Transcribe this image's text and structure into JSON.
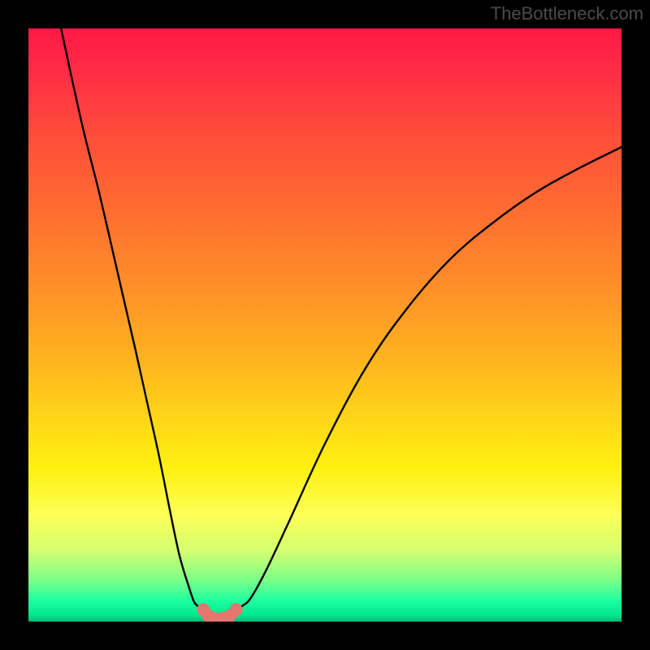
{
  "watermark": "TheBottleneck.com",
  "chart_data": {
    "type": "line",
    "title": "",
    "xlabel": "",
    "ylabel": "",
    "xlim": [
      0,
      100
    ],
    "ylim": [
      0,
      100
    ],
    "grid": false,
    "legend": false,
    "series": [
      {
        "name": "left-branch",
        "x": [
          5.5,
          9,
          12,
          15,
          18,
          20,
          22,
          24,
          25.5,
          27,
          28,
          29,
          29.5
        ],
        "y": [
          100,
          84,
          72,
          59,
          46,
          37,
          28,
          18,
          11,
          6,
          3.2,
          2.4,
          2
        ]
      },
      {
        "name": "right-branch",
        "x": [
          35,
          36,
          37.5,
          40,
          44,
          50,
          57,
          64,
          71,
          78,
          85,
          92,
          100
        ],
        "y": [
          2,
          2.6,
          4,
          8.5,
          17,
          30,
          43,
          53,
          61,
          67,
          72,
          76,
          80
        ]
      },
      {
        "name": "bottom-arc",
        "type": "scatter",
        "x": [
          29.5,
          30.3,
          31.0,
          32.0,
          33.0,
          34.0,
          35.0
        ],
        "y": [
          2.0,
          1.0,
          0.6,
          0.4,
          0.6,
          1.0,
          2.0
        ]
      }
    ],
    "colors": {
      "branch": "#000000",
      "arc_stroke": "#e4766e",
      "arc_fill": "#e4766e"
    },
    "estimates_note": "Axes are unlabeled in the source image; x and y are expressed in percent of plot width/height, read visually."
  }
}
